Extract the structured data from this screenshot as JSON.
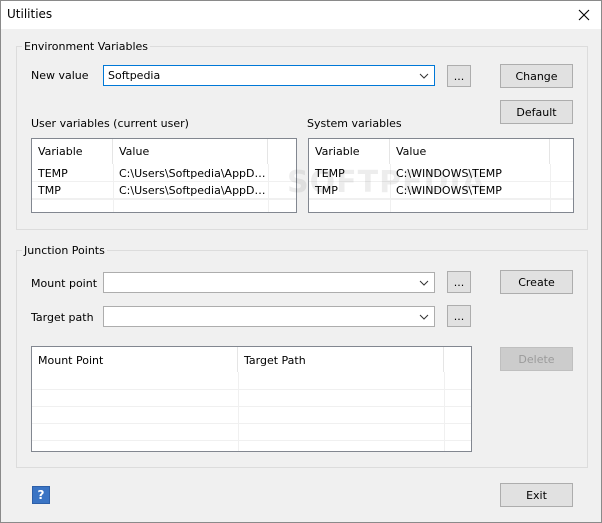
{
  "window": {
    "title": "Utilities",
    "close_icon": "close-icon"
  },
  "env": {
    "group_label": "Environment Variables",
    "new_value_label": "New value",
    "new_value": "Softpedia",
    "browse_label": "...",
    "change_label": "Change",
    "default_label": "Default",
    "user_vars_label": "User variables (current user)",
    "system_vars_label": "System variables",
    "user_table": {
      "columns": [
        "Variable",
        "Value"
      ],
      "rows": [
        [
          "TEMP",
          "C:\\Users\\Softpedia\\AppDat..."
        ],
        [
          "TMP",
          "C:\\Users\\Softpedia\\AppDat..."
        ]
      ]
    },
    "system_table": {
      "columns": [
        "Variable",
        "Value"
      ],
      "rows": [
        [
          "TEMP",
          "C:\\WINDOWS\\TEMP"
        ],
        [
          "TMP",
          "C:\\WINDOWS\\TEMP"
        ]
      ]
    }
  },
  "junction": {
    "group_label": "Junction Points",
    "mount_point_label": "Mount point",
    "mount_point_value": "",
    "target_path_label": "Target path",
    "target_path_value": "",
    "browse_label": "...",
    "create_label": "Create",
    "delete_label": "Delete",
    "table": {
      "columns": [
        "Mount Point",
        "Target Path"
      ]
    }
  },
  "footer": {
    "help_label": "?",
    "exit_label": "Exit"
  },
  "watermark": "SOFTPEDIA"
}
